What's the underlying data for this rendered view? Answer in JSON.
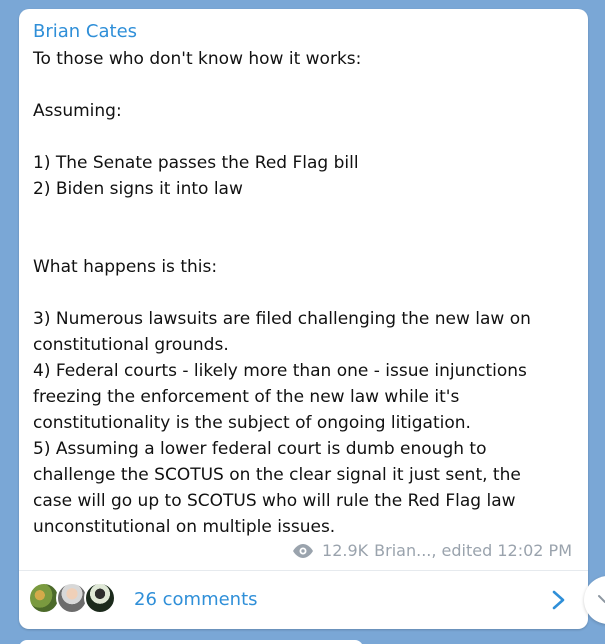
{
  "message": {
    "author": "Brian Cates",
    "lines": [
      "To those who don't know how it works:",
      "",
      "Assuming:",
      "",
      "1) The Senate passes the Red Flag bill",
      "2) Biden signs it into law",
      "",
      "",
      "What happens is this:",
      "",
      "3) Numerous lawsuits are filed challenging the new law on",
      "constitutional grounds.",
      "4) Federal courts - likely more than one - issue injunctions",
      "freezing the enforcement of the new law while it's",
      "constitutionality is the subject of ongoing litigation.",
      "5) Assuming a lower federal court is dumb enough to",
      "challenge the SCOTUS on the clear signal it just sent, the",
      "case will go up to SCOTUS who will rule the Red Flag law",
      "unconstitutional on multiple issues."
    ],
    "views": "12.9K",
    "signature": "Brian..., edited 12:02 PM"
  },
  "comments": {
    "label": "26 comments"
  },
  "icons": {
    "views": "eye-icon",
    "comments_arrow": "chevron-right-icon",
    "round_button": "chevron-down-icon"
  },
  "colors": {
    "background": "#7aa7d6",
    "accent": "#2f8fd8",
    "meta": "#9aa3ad",
    "card": "#ffffff"
  }
}
